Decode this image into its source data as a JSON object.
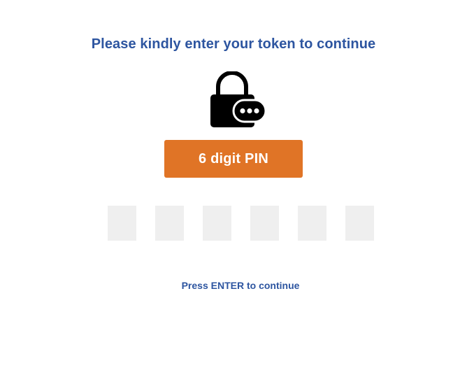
{
  "header": {
    "title": "Please kindly enter your token to continue"
  },
  "lock": {
    "icon": "lock-with-pin-dots-icon",
    "color": "#000000"
  },
  "pin_button": {
    "label": "6 digit PIN",
    "color": "#e07426"
  },
  "pin_inputs": [
    {
      "value": ""
    },
    {
      "value": ""
    },
    {
      "value": ""
    },
    {
      "value": ""
    },
    {
      "value": ""
    },
    {
      "value": ""
    }
  ],
  "footer": {
    "hint": "Press ENTER to continue"
  },
  "colors": {
    "accent_text": "#2d55a0",
    "input_background": "#efefef"
  }
}
